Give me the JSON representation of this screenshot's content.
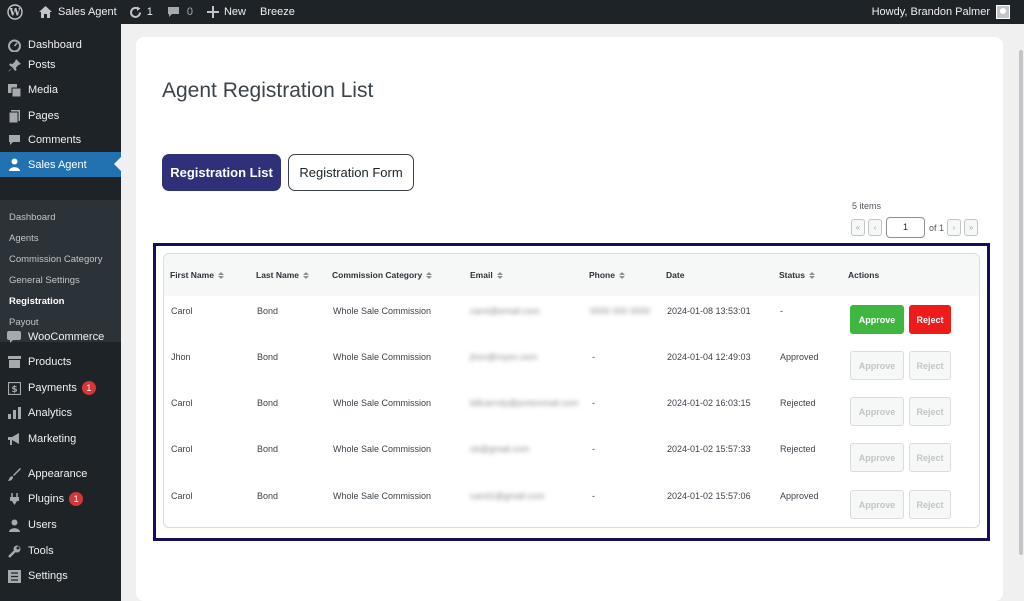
{
  "adminbar": {
    "site_name": "Sales Agent",
    "updates_count": "1",
    "comments_count": "0",
    "new_label": "New",
    "breeze_label": "Breeze",
    "howdy": "Howdy, Brandon Palmer"
  },
  "sidebar": {
    "menu": [
      {
        "label": "Dashboard",
        "icon": "dashboard-icon"
      },
      {
        "label": "Posts",
        "icon": "pin-icon"
      },
      {
        "label": "Media",
        "icon": "media-icon"
      },
      {
        "label": "Pages",
        "icon": "pages-icon"
      },
      {
        "label": "Comments",
        "icon": "comment-icon"
      },
      {
        "label": "Sales Agent",
        "icon": "users-icon"
      },
      {
        "label": "WooCommerce",
        "icon": "woo-icon"
      },
      {
        "label": "Products",
        "icon": "archive-icon"
      },
      {
        "label": "Payments",
        "icon": "dollar-icon",
        "badge": "1"
      },
      {
        "label": "Analytics",
        "icon": "chart-icon"
      },
      {
        "label": "Marketing",
        "icon": "megaphone-icon"
      },
      {
        "label": "Appearance",
        "icon": "brush-icon"
      },
      {
        "label": "Plugins",
        "icon": "plugin-icon",
        "badge": "1"
      },
      {
        "label": "Users",
        "icon": "user-icon"
      },
      {
        "label": "Tools",
        "icon": "wrench-icon"
      },
      {
        "label": "Settings",
        "icon": "settings-icon"
      }
    ],
    "submenu": [
      "Dashboard",
      "Agents",
      "Commission Category",
      "General Settings",
      "Registration",
      "Payout"
    ]
  },
  "page": {
    "title": "Agent Registration List",
    "tab_list": "Registration List",
    "tab_form": "Registration Form",
    "items_count": "5 items",
    "pager": {
      "first": "«",
      "prev": "‹",
      "current": "1",
      "of": "of 1",
      "next": "›",
      "last": "»"
    }
  },
  "table": {
    "headers": [
      "First Name",
      "Last Name",
      "Commission Category",
      "Email",
      "Phone",
      "Date",
      "Status",
      "Actions"
    ],
    "approve_label": "Approve",
    "reject_label": "Reject",
    "rows": [
      {
        "first": "Carol",
        "last": "Bond",
        "category": "Whole Sale Commission",
        "email": "carol@email.com",
        "phone": "0000 000 0000",
        "date": "2024-01-08 13:53:01",
        "status": "-",
        "actions_enabled": true
      },
      {
        "first": "Jhon",
        "last": "Bond",
        "category": "Whole Sale Commission",
        "email": "jhon@mysn.com",
        "phone": "-",
        "date": "2024-01-04 12:49:03",
        "status": "Approved",
        "actions_enabled": false
      },
      {
        "first": "Carol",
        "last": "Bond",
        "category": "Whole Sale Commission",
        "email": "billcarroly@protonmail.com",
        "phone": "-",
        "date": "2024-01-02 16:03:15",
        "status": "Rejected",
        "actions_enabled": false
      },
      {
        "first": "Carol",
        "last": "Bond",
        "category": "Whole Sale Commission",
        "email": "cb@gmail.com",
        "phone": "-",
        "date": "2024-01-02 15:57:33",
        "status": "Rejected",
        "actions_enabled": false
      },
      {
        "first": "Carol",
        "last": "Bond",
        "category": "Whole Sale Commission",
        "email": "carol1@gmail.com",
        "phone": "-",
        "date": "2024-01-02 15:57:06",
        "status": "Approved",
        "actions_enabled": false
      }
    ]
  },
  "colors": {
    "primary": "#2e317a",
    "approve": "#3fb63f",
    "reject": "#ee1b1b",
    "active_menu": "#2271b1",
    "highlight_frame": "#120f5c"
  }
}
